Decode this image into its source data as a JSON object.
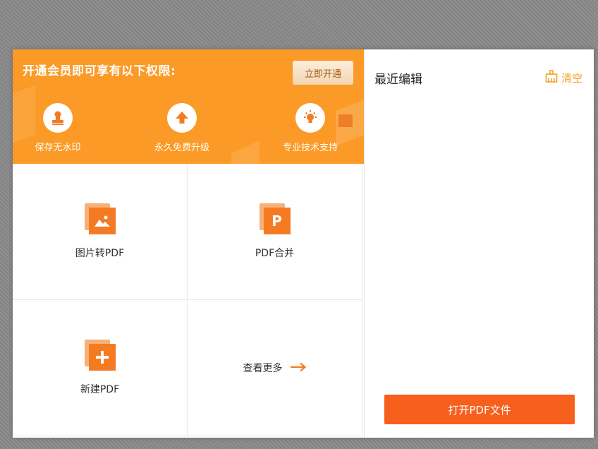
{
  "banner": {
    "title": "开通会员即可享有以下权限:",
    "join_button": "立即开通",
    "benefits": [
      {
        "label": "保存无水印",
        "icon": "stamp-icon"
      },
      {
        "label": "永久免费升级",
        "icon": "upgrade-arrow-icon"
      },
      {
        "label": "专业技术支持",
        "icon": "lightbulb-icon"
      }
    ]
  },
  "tools": [
    {
      "label": "图片转PDF",
      "icon": "image-to-pdf-icon"
    },
    {
      "label": "PDF合并",
      "icon": "pdf-merge-icon",
      "glyph": "P"
    },
    {
      "label": "新建PDF",
      "icon": "new-pdf-icon"
    },
    {
      "label": "查看更多",
      "icon": "arrow-right-icon"
    }
  ],
  "recent": {
    "title": "最近编辑",
    "clear_label": "清空",
    "clear_icon": "broom-icon",
    "open_button": "打开PDF文件"
  },
  "colors": {
    "banner": "#fb9a26",
    "accent": "#f47b22",
    "open_button": "#f75f1d",
    "clear": "#f6a02c"
  }
}
